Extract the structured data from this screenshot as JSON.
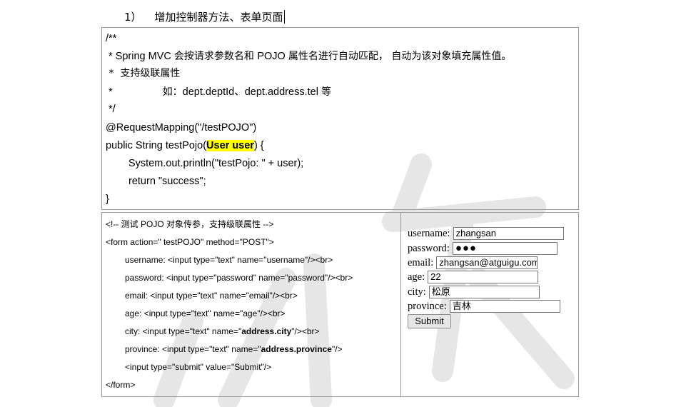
{
  "heading": {
    "number": "1）",
    "text": "增加控制器方法、表单页面"
  },
  "controller_code": {
    "line1": "/**",
    "line2_prefix": " * Spring MVC ",
    "line2_cjk1": "会按请求参数名和 ",
    "line2_pojo": "POJO ",
    "line2_cjk2": "属性名进行自动匹配， 自动为该对象填充属性值。",
    "line3": " *  支持级联属性",
    "line4_star": " *",
    "line4_cjk": "如：",
    "line4_code": "dept.deptId、dept.address.tel ",
    "line4_tail": "等",
    "line5": " */",
    "line6": "@RequestMapping(\"/testPOJO\")",
    "line7_prefix": "public String testPojo(",
    "line7_param": "User user",
    "line7_suffix": ") {",
    "line8": "System.out.println(\"testPojo: \" + user);",
    "line9": "return \"success\";",
    "line10": "}"
  },
  "form_code": {
    "line1": "<!-- 测试 POJO 对象传参，支持级联属性 -->",
    "line2": "<form action=\" testPOJO\" method=\"POST\">",
    "line3": "username: <input type=\"text\" name=\"username\"/><br>",
    "line4": "password: <input type=\"password\" name=\"password\"/><br>",
    "line5": "email: <input type=\"text\" name=\"email\"/><br>",
    "line6": "age: <input type=\"text\" name=\"age\"/><br>",
    "line7_prefix": "city: <input type=\"text\" name=\"",
    "line7_bold": "address.city",
    "line7_suffix": "\"/><br>",
    "line8_prefix": "province: <input type=\"text\" name=\"",
    "line8_bold": "address.province",
    "line8_suffix": "\"/>",
    "line9": "<input type=\"submit\" value=\"Submit\"/>",
    "line10": "</form>"
  },
  "rendered_form": {
    "username_label": "username:",
    "username_value": "zhangsan",
    "password_label": "password:",
    "password_value": "●●●",
    "email_label": "email:",
    "email_value": "zhangsan@atguigu.com",
    "age_label": "age:",
    "age_value": "22",
    "city_label": "city:",
    "city_value": "松原",
    "province_label": "province:",
    "province_value": "吉林",
    "submit_label": "Submit"
  },
  "colors": {
    "highlight": "#ffff00",
    "border": "#9a9a9a",
    "spellcheck": "#d33",
    "watermark": "#e6e6e6"
  }
}
